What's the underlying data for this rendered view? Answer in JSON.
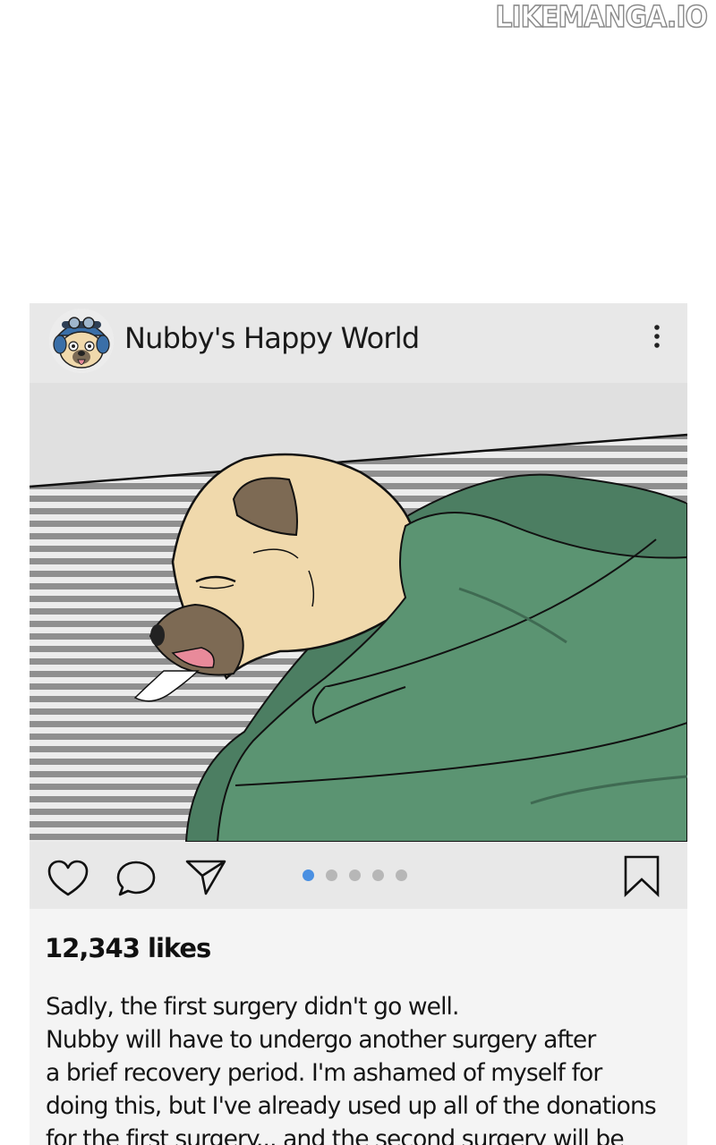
{
  "watermark": "LIKEMANGA.IO",
  "post": {
    "username": "Nubby's Happy World",
    "likes": "12,343 likes",
    "caption_lines": [
      "Sadly, the first surgery didn't go well.",
      "Nubby will have to undergo another surgery after",
      "a brief recovery period. I'm ashamed of myself for",
      "doing this, but I've already used up all of the donations",
      "for the first surgery... and the second surgery will be"
    ],
    "carousel": {
      "count": 5,
      "active_index": 0
    },
    "icons": {
      "more": "more-options-icon",
      "like": "heart-icon",
      "comment": "comment-icon",
      "share": "send-icon",
      "save": "bookmark-icon"
    }
  },
  "colors": {
    "header_bg": "#e8e8e8",
    "post_bg": "#f4f4f4",
    "active_dot": "#4a90e2",
    "inactive_dot": "#b7b7b7",
    "blanket": "#5b9472",
    "dog_fur": "#f0d9ac"
  }
}
